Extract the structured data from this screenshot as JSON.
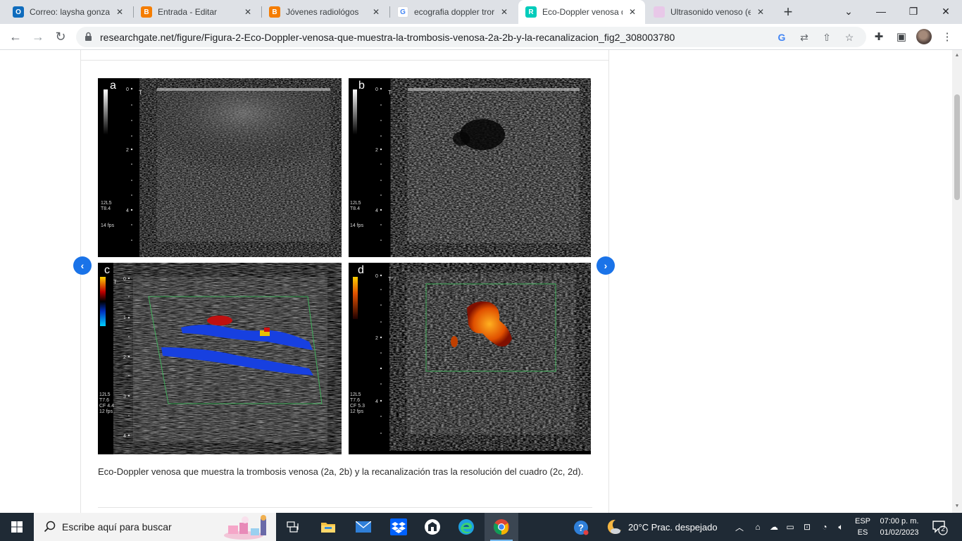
{
  "browser": {
    "tabs": [
      {
        "title": "Correo: laysha gonzale",
        "icon": "outlook-icon",
        "color": "#0f6cbd",
        "active": false
      },
      {
        "title": "Entrada - Editar",
        "icon": "blogger-icon",
        "color": "#f57d00",
        "active": false
      },
      {
        "title": "Jóvenes radiológos",
        "icon": "blogger-icon",
        "color": "#f57d00",
        "active": false
      },
      {
        "title": "ecografia doppler tror",
        "icon": "google-icon",
        "color": "#4285f4",
        "active": false
      },
      {
        "title": "Eco-Doppler venosa q",
        "icon": "researchgate-icon",
        "color": "#00ccbb",
        "active": true
      },
      {
        "title": "Ultrasonido venoso (e",
        "icon": "page-icon",
        "color": "#c9a0c9",
        "active": false
      }
    ],
    "url": "researchgate.net/figure/Figura-2-Eco-Doppler-venosa-que-muestra-la-trombosis-venosa-2a-2b-y-la-recanalizacion_fig2_308003780",
    "new_tab": "+"
  },
  "figure": {
    "panels": [
      {
        "letter": "a",
        "info": "12L5\nT8.4\n\n\n14 fps"
      },
      {
        "letter": "b",
        "info": "12L5\nT8.4\n\n\n14 fps"
      },
      {
        "letter": "c",
        "info": "12L5\nT7.6\nCF 4.4\n12 fps"
      },
      {
        "letter": "d",
        "info": "12L5\nT7.6\nCF 5.3\n12 fps"
      }
    ],
    "caption": "Eco-Doppler venosa que muestra la trombosis venosa (2a, 2b) y la recanalización tras la resolución del cuadro (2c, 2d).",
    "prev_arrow": "‹",
    "next_arrow": "›"
  },
  "taskbar": {
    "search_placeholder": "Escribe aquí para buscar",
    "weather": "20°C  Prac. despejado",
    "lang_top": "ESP",
    "lang_bottom": "ES",
    "time": "07:00 p. m.",
    "date": "01/02/2023",
    "notifications": "2"
  }
}
